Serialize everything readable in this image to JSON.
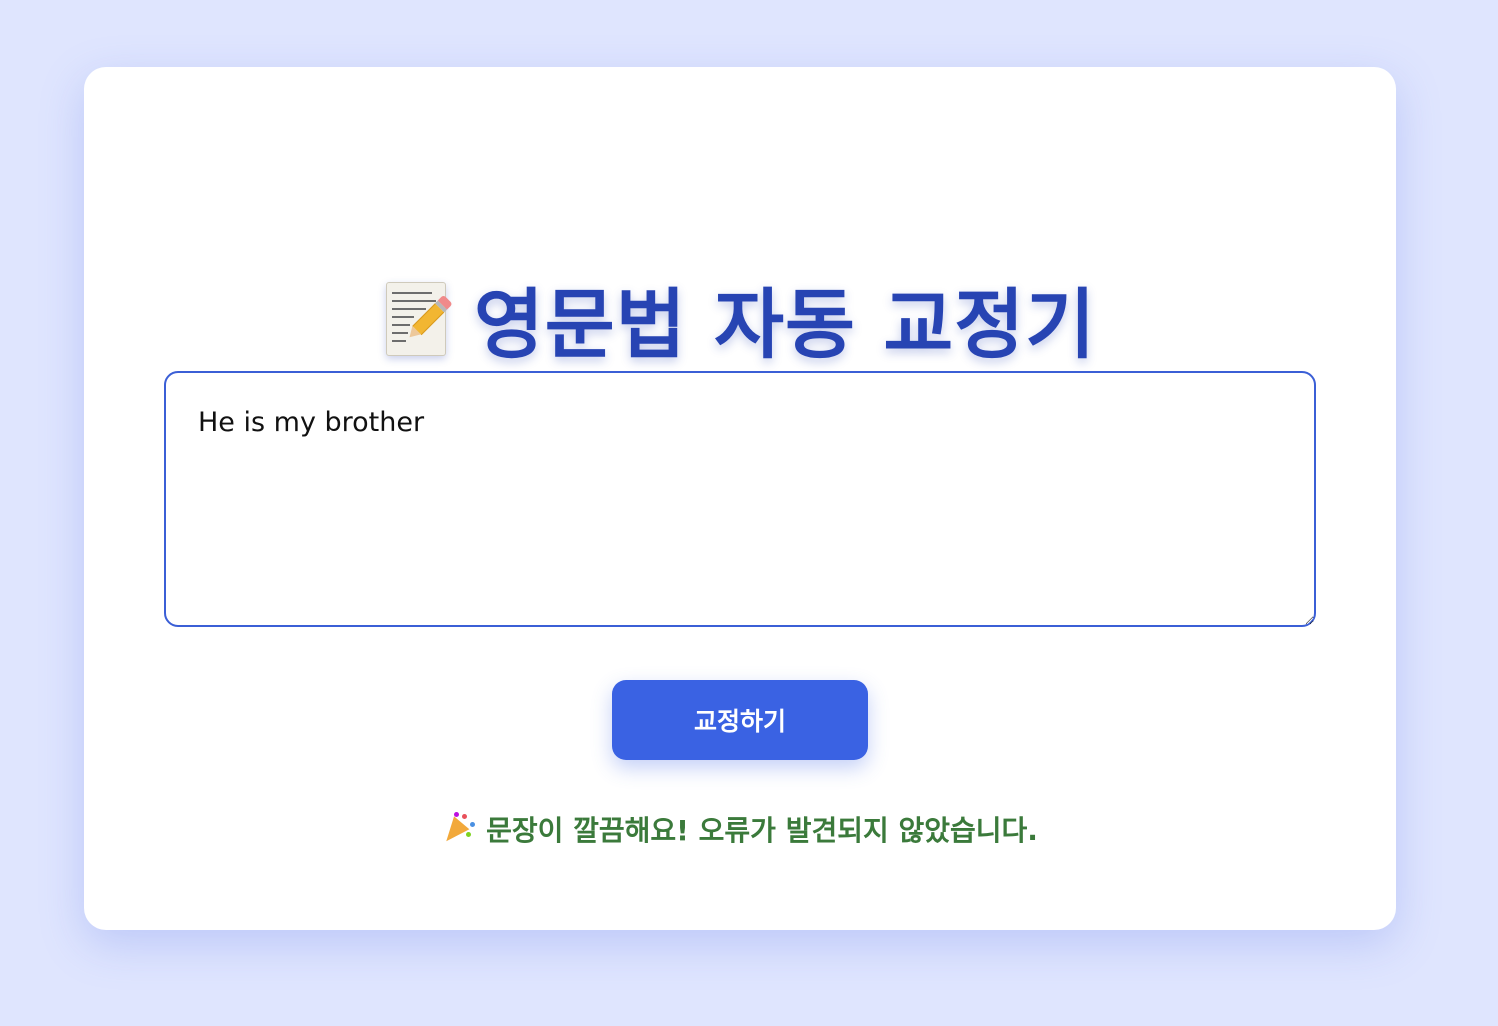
{
  "header": {
    "title": "영문법 자동 교정기",
    "title_icon": "memo-pencil-icon"
  },
  "editor": {
    "value": "He is my brother"
  },
  "actions": {
    "correct_label": "교정하기"
  },
  "result": {
    "icon": "party-popper-icon",
    "message": "문장이 깔끔해요! 오류가 발견되지 않았습니다."
  },
  "colors": {
    "background": "#dfe5fe",
    "title": "#2744b3",
    "accent": "#3a62e3",
    "success_text": "#3b7a3b"
  }
}
